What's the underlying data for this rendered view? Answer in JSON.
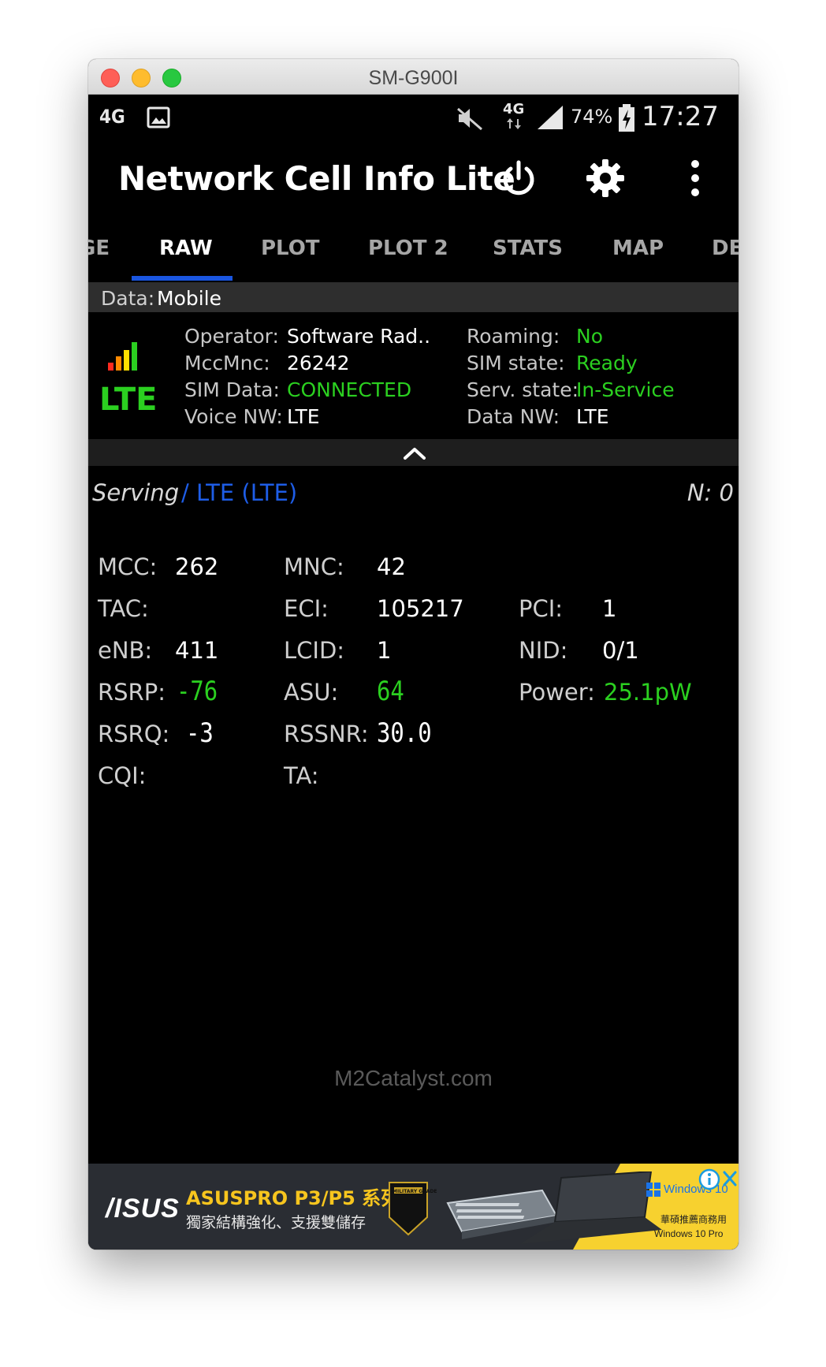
{
  "window": {
    "title": "SM-G900I"
  },
  "status_bar": {
    "left_network": "4G",
    "network_type": "4G",
    "battery": "74%",
    "time": "17:27"
  },
  "app_bar": {
    "title": "Network Cell Info Lite",
    "icons": [
      "power-icon",
      "gear-icon",
      "more-vert-icon"
    ]
  },
  "tabs": [
    {
      "label": "GE",
      "active": false
    },
    {
      "label": "RAW",
      "active": true
    },
    {
      "label": "PLOT",
      "active": false
    },
    {
      "label": "PLOT 2",
      "active": false
    },
    {
      "label": "STATS",
      "active": false
    },
    {
      "label": "MAP",
      "active": false
    },
    {
      "label": "DE",
      "active": false
    }
  ],
  "data_bar": {
    "label": "Data:",
    "value": "Mobile"
  },
  "info": {
    "tech": "LTE",
    "operator_label": "Operator:",
    "operator_value": "Software Rad..",
    "mccmnc_label": "MccMnc:",
    "mccmnc_value": "26242",
    "simdata_label": "SIM Data:",
    "simdata_value": "CONNECTED",
    "voicenw_label": "Voice NW:",
    "voicenw_value": "LTE",
    "roaming_label": "Roaming:",
    "roaming_value": "No",
    "simstate_label": "SIM state:",
    "simstate_value": "Ready",
    "servstate_label": "Serv. state:",
    "servstate_value": "In-Service",
    "datanw_label": "Data NW:",
    "datanw_value": "LTE"
  },
  "serving": {
    "label": "Serving",
    "tech": "/ LTE (LTE)",
    "neighbors": "N: 0",
    "mcc_label": "MCC:",
    "mcc_value": "262",
    "mnc_label": "MNC:",
    "mnc_value": "42",
    "tac_label": "TAC:",
    "tac_value": "",
    "eci_label": "ECI:",
    "eci_value": "105217",
    "pci_label": "PCI:",
    "pci_value": "1",
    "enb_label": "eNB:",
    "enb_value": "411",
    "lcid_label": "LCID:",
    "lcid_value": "1",
    "nid_label": "NID:",
    "nid_value": "0/1",
    "rsrp_label": "RSRP:",
    "rsrp_value": "-76",
    "asu_label": "ASU:",
    "asu_value": "64",
    "power_label": "Power:",
    "power_value": "25.1pW",
    "rsrq_label": "RSRQ:",
    "rsrq_value": "-3",
    "rssnr_label": "RSSNR:",
    "rssnr_value": "30.0",
    "cqi_label": "CQI:",
    "cqi_value": "",
    "ta_label": "TA:",
    "ta_value": ""
  },
  "footer": {
    "brand": "M2Catalyst.com"
  },
  "ad": {
    "brand": "/ISUS",
    "headline": "ASUSPRO P3/P5 系列",
    "subline": "獨家結構強化、支援雙儲存",
    "badge": "MILITARY GRADE",
    "os_name": "Windows 10",
    "recommend": "華碩推薦商務用",
    "os_edition": "Windows 10 Pro"
  },
  "colors": {
    "accent_blue": "#1a56e0",
    "value_green": "#2bd020",
    "serving_blue": "#1e5de6",
    "ad_yellow": "#f7d12f"
  }
}
